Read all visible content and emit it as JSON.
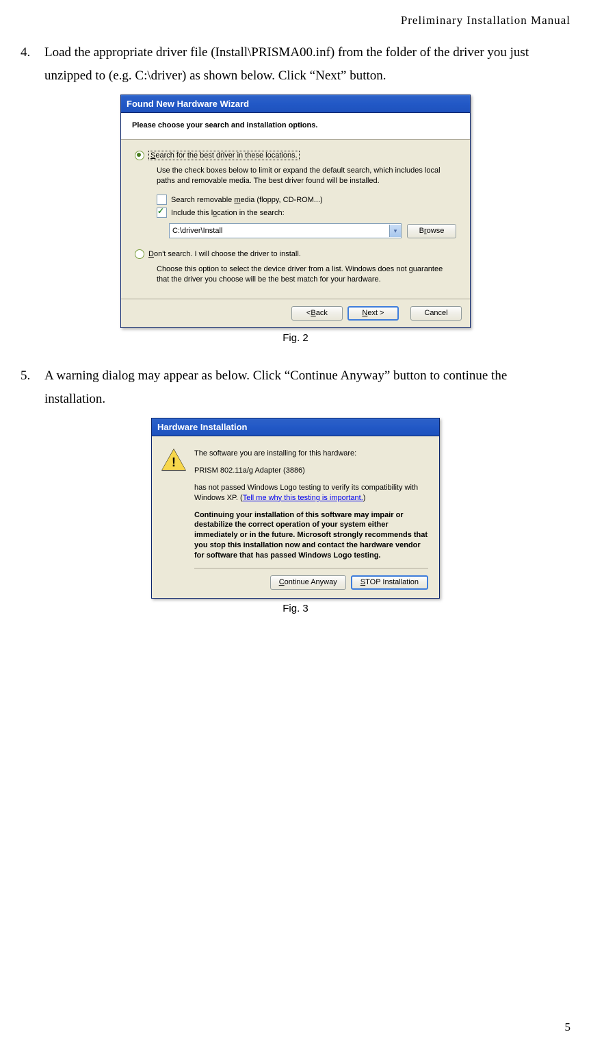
{
  "header": "Preliminary  Installation  Manual",
  "page_number": "5",
  "item4": {
    "number": "4.",
    "text": "Load the appropriate driver file (Install\\PRISMA00.inf) from the folder of the driver you just unzipped to (e.g. C:\\driver) as shown below. Click “Next” button."
  },
  "item5": {
    "number": "5.",
    "text": "A warning dialog may appear as below. Click “Continue Anyway” button to continue the installation."
  },
  "fig2_caption": "Fig. 2",
  "fig3_caption": "Fig. 3",
  "dialog1": {
    "title": "Found New Hardware Wizard",
    "header": "Please choose your search and installation options.",
    "radio1": "Search for the best driver in these locations.",
    "radio1_sub": "Use the check boxes below to limit or expand the default search, which includes local paths and removable media. The best driver found will be installed.",
    "checkbox1": "Search removable media (floppy, CD-ROM...)",
    "checkbox2": "Include this location in the search:",
    "path": "C:\\driver\\Install",
    "browse": "Browse",
    "radio2": "Don't search. I will choose the driver to install.",
    "radio2_sub": "Choose this option to select the device driver from a list.  Windows does not guarantee that the driver you choose will be the best match for your hardware.",
    "back": "< Back",
    "next": "Next >",
    "cancel": "Cancel"
  },
  "dialog2": {
    "title": "Hardware Installation",
    "line1": "The software you are installing for this hardware:",
    "device": "PRISM 802.11a/g Adapter (3886)",
    "line2_a": "has not passed Windows Logo testing to verify its compatibility with Windows XP. (",
    "link": "Tell me why this testing is important.",
    "line2_b": ")",
    "bold_warning": "Continuing your installation of this software may impair or destabilize the correct operation of your system either immediately or in the future. Microsoft strongly recommends that you stop this installation now and contact the hardware vendor for software that has passed Windows Logo testing.",
    "continue": "Continue Anyway",
    "stop": "STOP Installation"
  }
}
